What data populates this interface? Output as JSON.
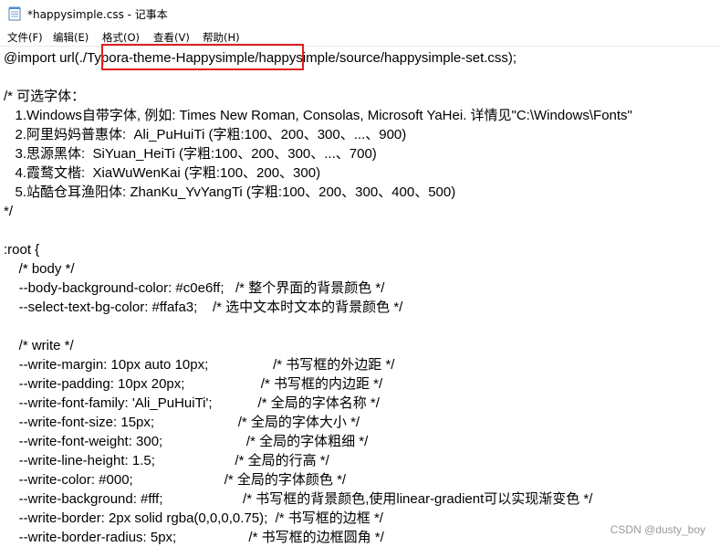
{
  "window": {
    "title": "*happysimple.css - 记事本"
  },
  "menu": {
    "items": [
      {
        "label": "文件(F)"
      },
      {
        "label": "编辑(E)"
      },
      {
        "label": "格式(O)"
      },
      {
        "label": "查看(V)"
      },
      {
        "label": "帮助(H)"
      }
    ]
  },
  "editor": {
    "lines": [
      "@import url(./Typora-theme-Happysimple/happysimple/source/happysimple-set.css);",
      "",
      "/* 可选字体：",
      "   1.Windows自带字体, 例如: Times New Roman, Consolas, Microsoft YaHei. 详情见\"C:\\Windows\\Fonts\"",
      "   2.阿里妈妈普惠体:  Ali_PuHuiTi (字粗:100、200、300、...、900)",
      "   3.思源黑体:  SiYuan_HeiTi (字粗:100、200、300、...、700)",
      "   4.霞鹜文楷:  XiaWuWenKai (字粗:100、200、300)",
      "   5.站酷仓耳渔阳体: ZhanKu_YvYangTi (字粗:100、200、300、400、500)",
      "*/",
      "",
      ":root {",
      "    /* body */",
      "    --body-background-color: #c0e6ff;   /* 整个界面的背景颜色 */",
      "    --select-text-bg-color: #ffafa3;    /* 选中文本时文本的背景颜色 */",
      "",
      "    /* write */",
      "    --write-margin: 10px auto 10px;                 /* 书写框的外边距 */",
      "    --write-padding: 10px 20px;                    /* 书写框的内边距 */",
      "    --write-font-family: 'Ali_PuHuiTi';            /* 全局的字体名称 */",
      "    --write-font-size: 15px;                      /* 全局的字体大小 */",
      "    --write-font-weight: 300;                      /* 全局的字体粗细 */",
      "    --write-line-height: 1.5;                     /* 全局的行高 */",
      "    --write-color: #000;                        /* 全局的字体颜色 */",
      "    --write-background: #fff;                     /* 书写框的背景颜色,使用linear-gradient可以实现渐变色 */",
      "    --write-border: 2px solid rgba(0,0,0,0.75);  /* 书写框的边框 */",
      "    --write-border-radius: 5px;                   /* 书写框的边框圆角 */"
    ]
  },
  "watermark": {
    "text": "CSDN @dusty_boy"
  },
  "colors": {
    "highlight_border": "#e02020",
    "watermark": "#9a9a9a"
  }
}
